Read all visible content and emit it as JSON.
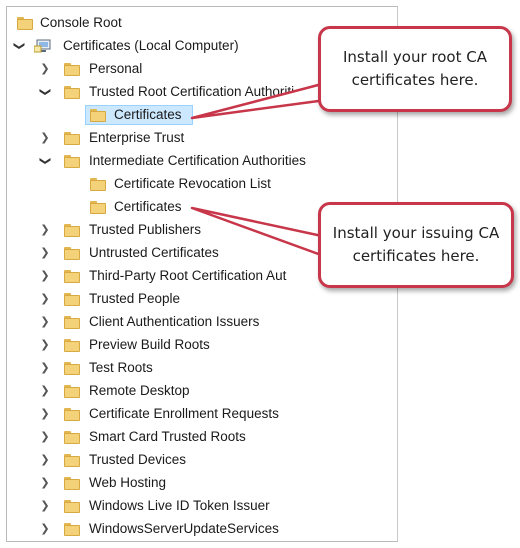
{
  "tree": {
    "root": "Console Root",
    "computer": "Certificates (Local Computer)",
    "items": {
      "personal": "Personal",
      "trusted_root": "Trusted Root Certification Authoriti",
      "trusted_root_certs": "Certificates",
      "enterprise_trust": "Enterprise Trust",
      "intermediate": "Intermediate Certification Authorities",
      "crl": "Certificate Revocation List",
      "intermediate_certs": "Certificates",
      "trusted_publishers": "Trusted Publishers",
      "untrusted": "Untrusted Certificates",
      "third_party": "Third-Party Root Certification Aut",
      "trusted_people": "Trusted People",
      "client_auth": "Client Authentication Issuers",
      "preview_build": "Preview Build Roots",
      "test_roots": "Test Roots",
      "remote_desktop": "Remote Desktop",
      "enrollment": "Certificate Enrollment Requests",
      "smart_card": "Smart Card Trusted Roots",
      "trusted_devices": "Trusted Devices",
      "web_hosting": "Web Hosting",
      "live_id": "Windows Live ID Token Issuer",
      "wsus": "WindowsServerUpdateServices"
    }
  },
  "callouts": {
    "root": [
      "Install your root CA",
      "certificates here."
    ],
    "issuing": [
      "Install your issuing CA",
      "certificates here."
    ]
  },
  "colors": {
    "callout_border": "#c8364a",
    "selection": "#cce8ff",
    "folder": "#f3d27a"
  }
}
